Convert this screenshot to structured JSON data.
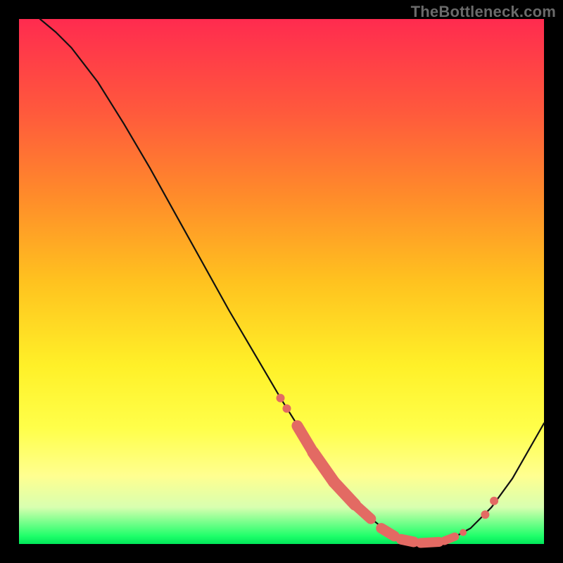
{
  "watermark": "TheBottleneck.com",
  "colors": {
    "black": "#000000",
    "curve": "#111111",
    "dot": "#e36a63",
    "gradient_top": "#ff2b4f",
    "gradient_bottom": "#00e659"
  },
  "chart_data": {
    "type": "line",
    "title": "",
    "xlabel": "",
    "ylabel": "",
    "xlim": [
      0,
      1000
    ],
    "ylim": [
      0,
      1000
    ],
    "grid": false,
    "curve": [
      {
        "x": 40,
        "y": 1000
      },
      {
        "x": 70,
        "y": 975
      },
      {
        "x": 100,
        "y": 945
      },
      {
        "x": 150,
        "y": 880
      },
      {
        "x": 200,
        "y": 800
      },
      {
        "x": 250,
        "y": 715
      },
      {
        "x": 300,
        "y": 625
      },
      {
        "x": 350,
        "y": 535
      },
      {
        "x": 400,
        "y": 445
      },
      {
        "x": 450,
        "y": 360
      },
      {
        "x": 500,
        "y": 275
      },
      {
        "x": 550,
        "y": 195
      },
      {
        "x": 600,
        "y": 125
      },
      {
        "x": 650,
        "y": 65
      },
      {
        "x": 700,
        "y": 25
      },
      {
        "x": 740,
        "y": 8
      },
      {
        "x": 780,
        "y": 2
      },
      {
        "x": 820,
        "y": 8
      },
      {
        "x": 860,
        "y": 30
      },
      {
        "x": 900,
        "y": 70
      },
      {
        "x": 940,
        "y": 125
      },
      {
        "x": 980,
        "y": 195
      },
      {
        "x": 1000,
        "y": 230
      }
    ],
    "dots_small": [
      {
        "x": 498,
        "y": 278,
        "r": 6
      },
      {
        "x": 510,
        "y": 258,
        "r": 6
      },
      {
        "x": 846,
        "y": 22,
        "r": 5
      },
      {
        "x": 888,
        "y": 56,
        "r": 6
      },
      {
        "x": 905,
        "y": 82,
        "r": 6
      }
    ],
    "dots_elongated": [
      {
        "x1": 530,
        "y1": 225,
        "x2": 560,
        "y2": 175,
        "w": 16
      },
      {
        "x1": 560,
        "y1": 175,
        "x2": 600,
        "y2": 118,
        "w": 17
      },
      {
        "x1": 600,
        "y1": 118,
        "x2": 640,
        "y2": 75,
        "w": 17
      },
      {
        "x1": 640,
        "y1": 75,
        "x2": 670,
        "y2": 48,
        "w": 15
      },
      {
        "x1": 690,
        "y1": 30,
        "x2": 715,
        "y2": 15,
        "w": 15
      },
      {
        "x1": 728,
        "y1": 9,
        "x2": 752,
        "y2": 4,
        "w": 15
      },
      {
        "x1": 765,
        "y1": 2,
        "x2": 800,
        "y2": 4,
        "w": 14
      },
      {
        "x1": 810,
        "y1": 6,
        "x2": 830,
        "y2": 14,
        "w": 12
      }
    ]
  }
}
